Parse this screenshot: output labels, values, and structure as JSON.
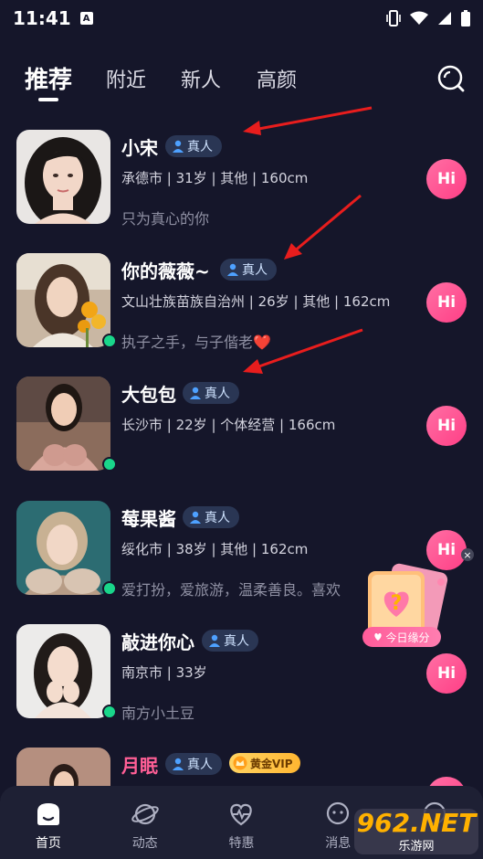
{
  "status_bar": {
    "time": "11:41",
    "a_badge": "A"
  },
  "tabs": [
    "推荐",
    "附近",
    "新人",
    "高颜"
  ],
  "cards": [
    {
      "name": "小宋",
      "badge": "真人",
      "info": "承德市 | 31岁 | 其他 | 160cm",
      "bio": "只为真心的你",
      "hi": "Hi",
      "online": false
    },
    {
      "name": "你的薇薇~",
      "badge": "真人",
      "info": "文山壮族苗族自治州 | 26岁 | 其他 | 162cm",
      "bio": "执子之手，与子偕老❤️",
      "hi": "Hi",
      "online": true
    },
    {
      "name": "大包包",
      "badge": "真人",
      "info": "长沙市 | 22岁 | 个体经营 | 166cm",
      "bio": "",
      "hi": "Hi",
      "online": true
    },
    {
      "name": "莓果酱",
      "badge": "真人",
      "info": "绥化市 | 38岁 | 其他 | 162cm",
      "bio": "爱打扮，爱旅游，温柔善良。喜欢",
      "hi": "Hi",
      "online": true
    },
    {
      "name": "敲进你心",
      "badge": "真人",
      "info": "南京市 | 33岁",
      "bio": "南方小土豆",
      "hi": "Hi",
      "online": true
    },
    {
      "name": "月眠",
      "badge": "真人",
      "vip": "黄金VIP",
      "info": "",
      "bio": "",
      "hi": "Hi",
      "online": false
    }
  ],
  "float_widget": {
    "label": "今日缘分",
    "close": "×"
  },
  "bottom_nav": [
    {
      "label": "首页",
      "icon": "home-icon"
    },
    {
      "label": "动态",
      "icon": "planet-icon"
    },
    {
      "label": "特惠",
      "icon": "heart-pulse-icon"
    },
    {
      "label": "消息",
      "icon": "chat-icon"
    },
    {
      "label": "",
      "icon": "profile-icon"
    }
  ],
  "watermark": {
    "top": "962.NET",
    "bottom": "乐游网"
  },
  "colors": {
    "background": "#15162a",
    "accent_pink": "#ff3f86",
    "online_green": "#19d68a",
    "badge_bg": "#2a3654"
  }
}
